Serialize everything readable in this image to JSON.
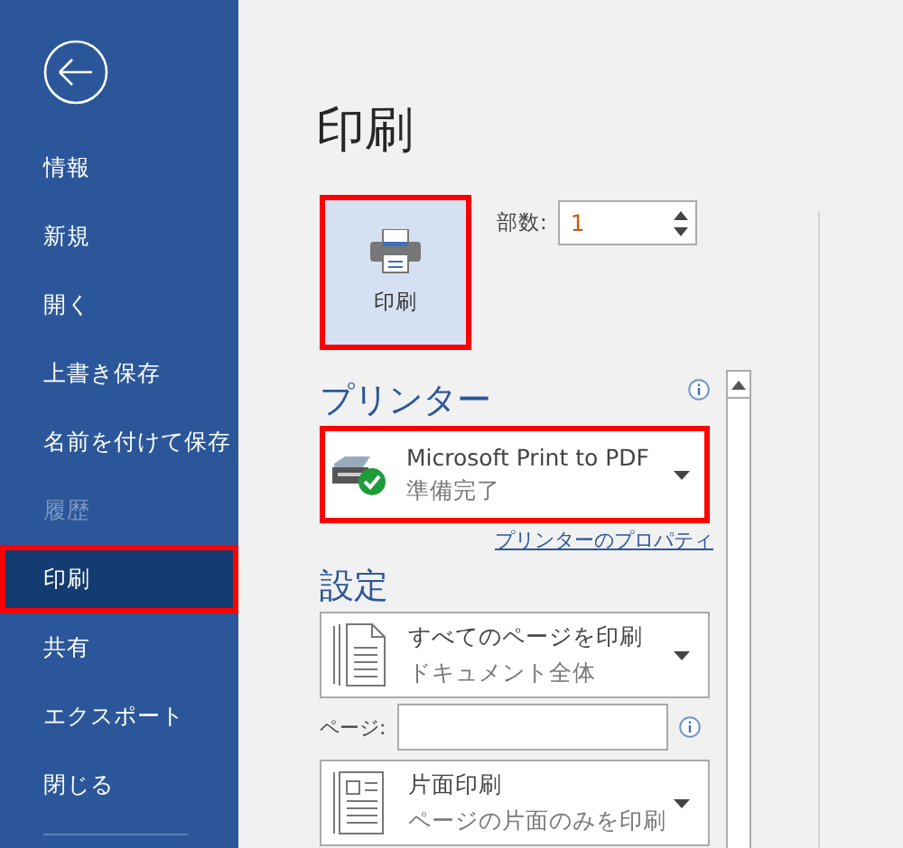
{
  "sidebar": {
    "items": [
      {
        "label": "情報",
        "selected": false,
        "disabled": false,
        "highlighted": false
      },
      {
        "label": "新規",
        "selected": false,
        "disabled": false,
        "highlighted": false
      },
      {
        "label": "開く",
        "selected": false,
        "disabled": false,
        "highlighted": false
      },
      {
        "label": "上書き保存",
        "selected": false,
        "disabled": false,
        "highlighted": false
      },
      {
        "label": "名前を付けて保存",
        "selected": false,
        "disabled": false,
        "highlighted": false
      },
      {
        "label": "履歴",
        "selected": false,
        "disabled": true,
        "highlighted": false
      },
      {
        "label": "印刷",
        "selected": true,
        "disabled": false,
        "highlighted": true
      },
      {
        "label": "共有",
        "selected": false,
        "disabled": false,
        "highlighted": false
      },
      {
        "label": "エクスポート",
        "selected": false,
        "disabled": false,
        "highlighted": false
      },
      {
        "label": "閉じる",
        "selected": false,
        "disabled": false,
        "highlighted": false
      }
    ]
  },
  "title": "印刷",
  "print_button": {
    "label": "印刷",
    "highlighted": true
  },
  "copies": {
    "label": "部数:",
    "value": "1"
  },
  "printer": {
    "heading": "プリンター",
    "name": "Microsoft Print to PDF",
    "status": "準備完了",
    "highlighted": true,
    "link": "プリンターのプロパティ"
  },
  "settings": {
    "heading": "設定",
    "options": [
      {
        "kind": "dropdown",
        "title": "すべてのページを印刷",
        "subtitle": "ドキュメント全体"
      },
      {
        "kind": "field",
        "label": "ページ:"
      },
      {
        "kind": "dropdown",
        "title": "片面印刷",
        "subtitle": "ページの片面のみを印刷"
      }
    ]
  }
}
